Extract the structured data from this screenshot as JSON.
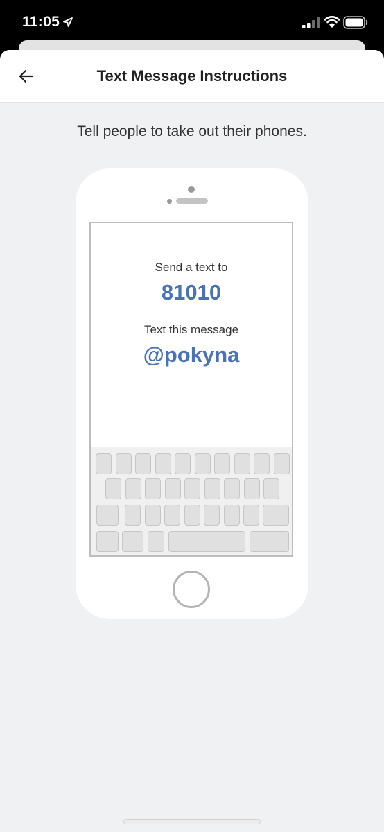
{
  "status_bar": {
    "time": "11:05",
    "icons": [
      "location-arrow-icon",
      "cellular-signal-icon",
      "wifi-icon",
      "battery-icon"
    ]
  },
  "nav": {
    "title": "Text Message Instructions",
    "back_icon": "arrow-left-icon"
  },
  "instruction": "Tell people to take out their phones.",
  "phone_screen": {
    "send_label": "Send a text to",
    "number": "81010",
    "message_label": "Text this message",
    "message": "@pokyna"
  },
  "colors": {
    "accent": "#4a73b5",
    "sheet_background": "#f0f1f3",
    "text": "#333333"
  }
}
